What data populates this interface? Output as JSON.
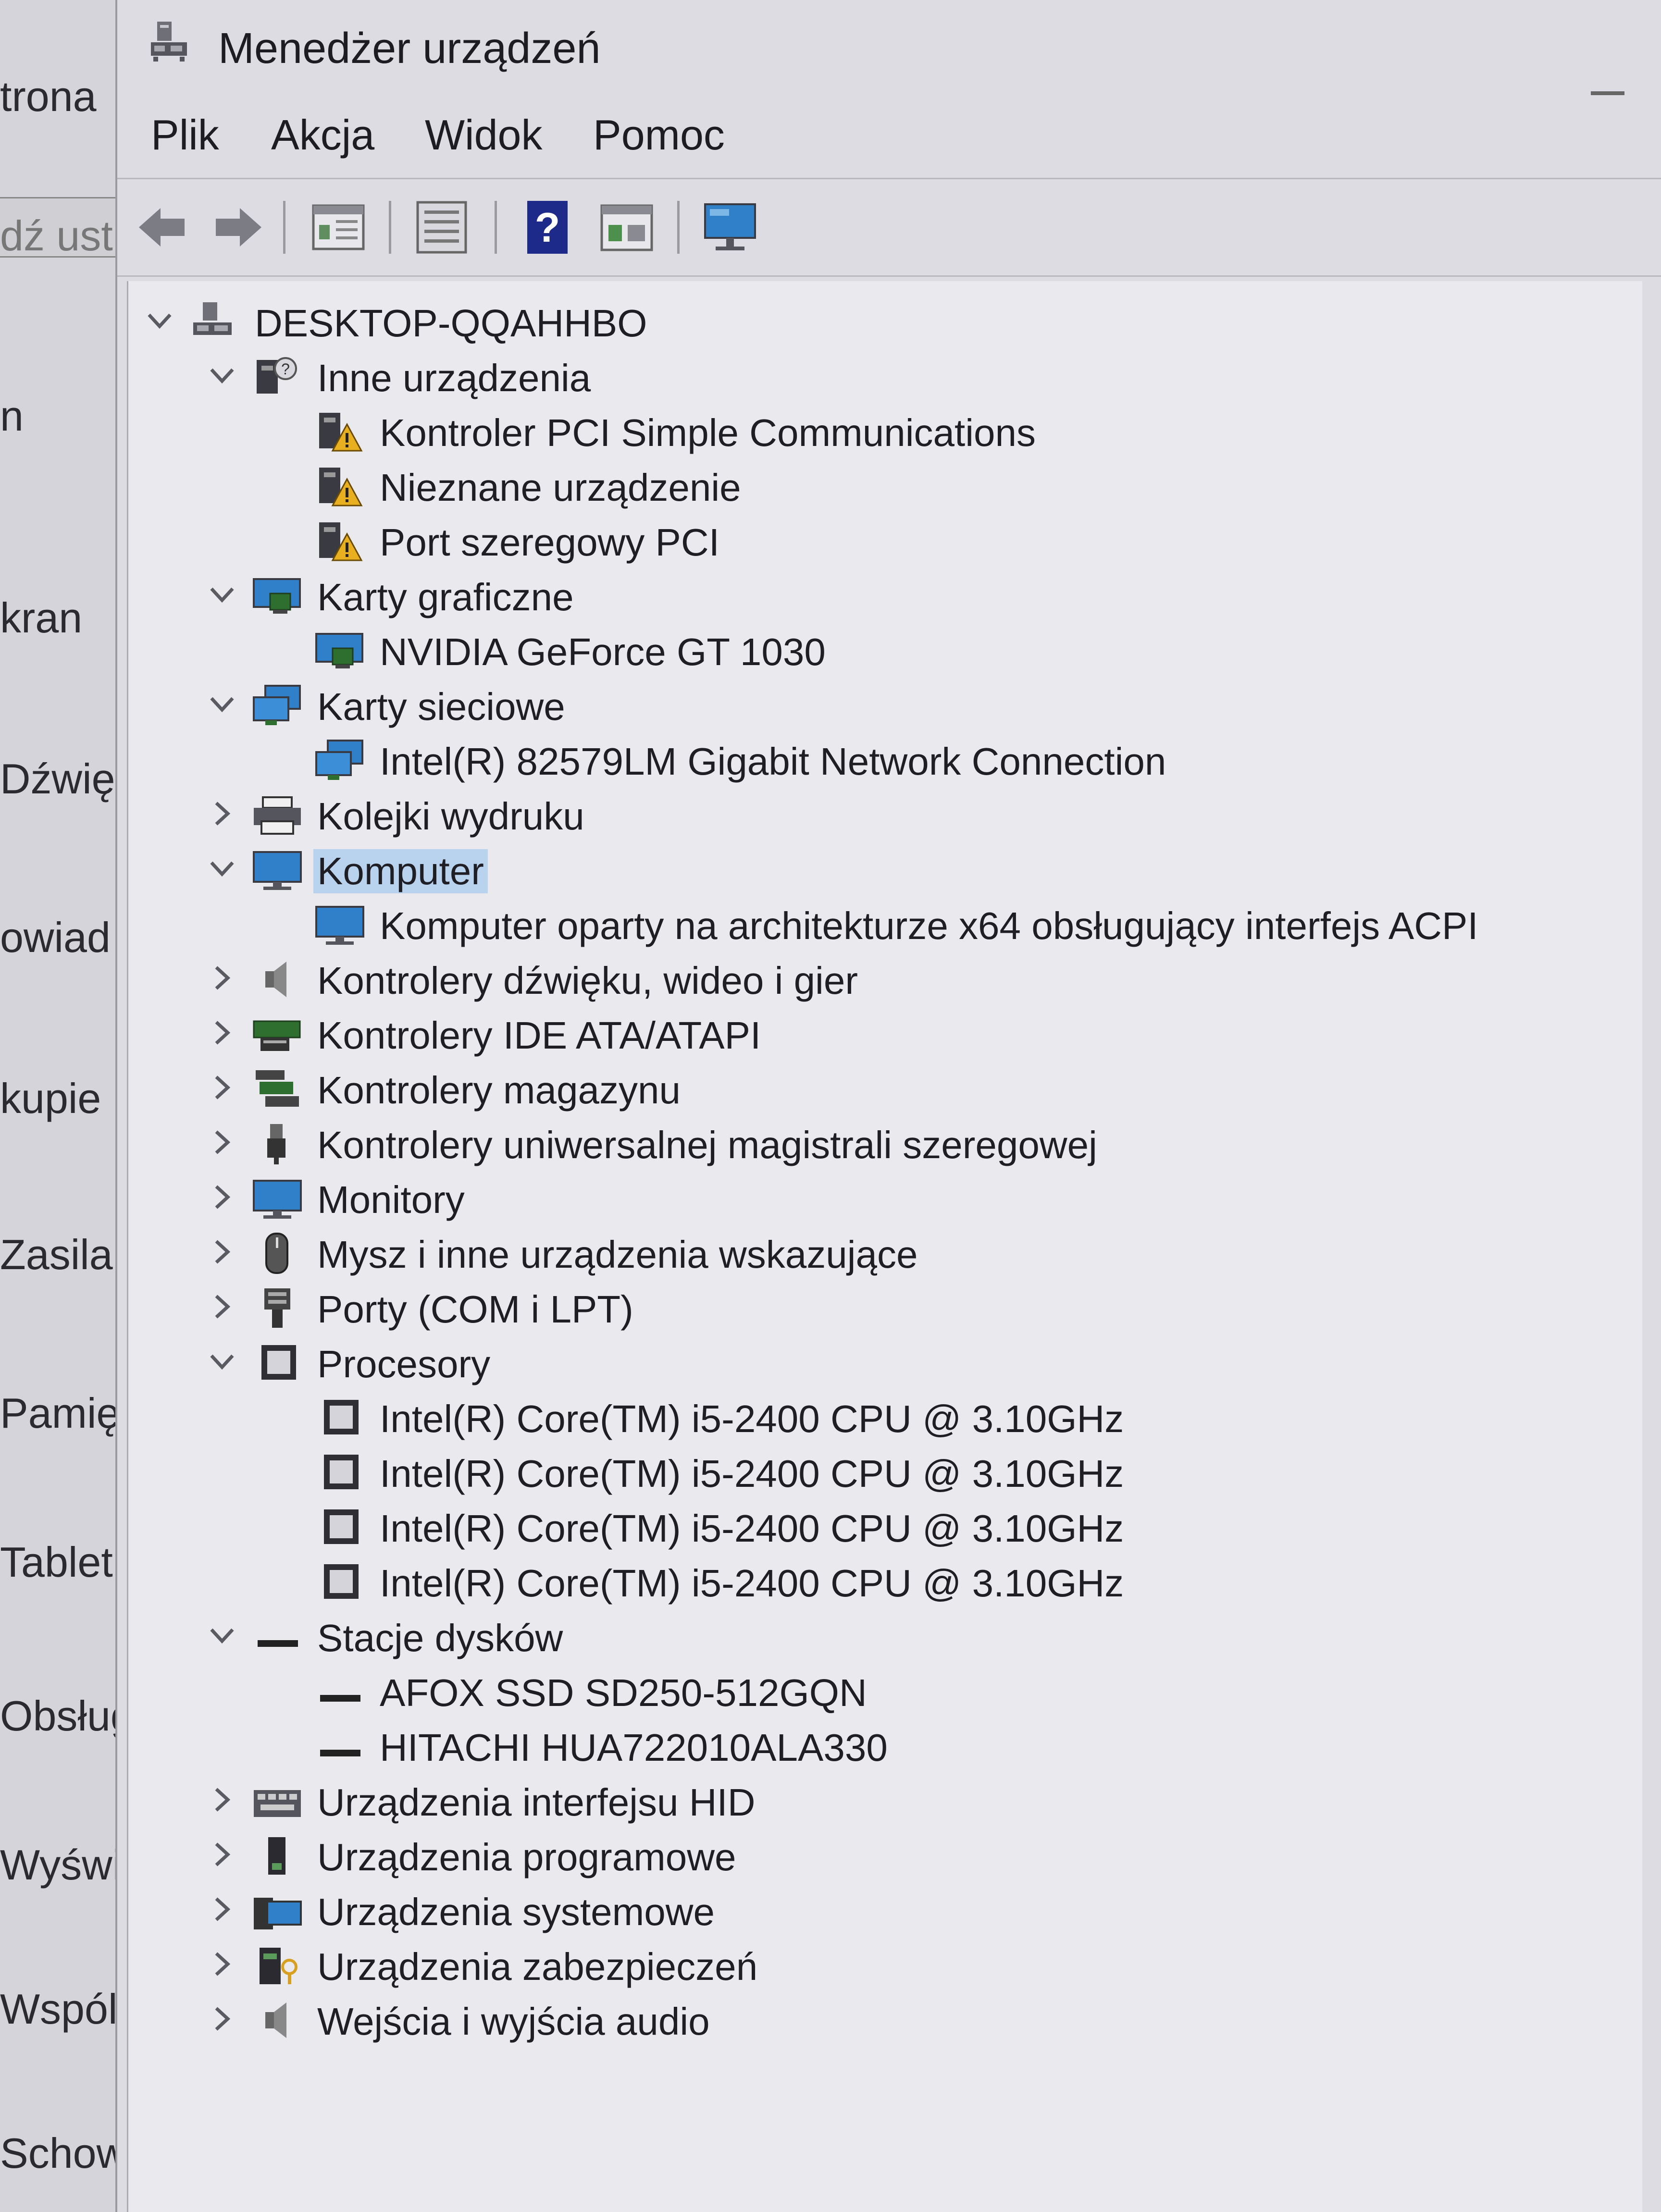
{
  "background_window": {
    "labels": [
      "trona",
      "dź ust",
      "n",
      "kran",
      "Dźwięk",
      "owiad",
      "kupie",
      "Zasilan",
      "Pamięć",
      "Tablet",
      "Obsług",
      "Wyświ",
      "Wspól",
      "Schow"
    ]
  },
  "window": {
    "title": "Menedżer urządzeń"
  },
  "menu": {
    "items": [
      "Plik",
      "Akcja",
      "Widok",
      "Pomoc"
    ]
  },
  "toolbar": {
    "buttons": [
      "back-arrow",
      "forward-arrow",
      "properties-window",
      "update-driver",
      "help",
      "run-window",
      "monitor"
    ]
  },
  "tree": {
    "root": "DESKTOP-QQAHHBO",
    "items": [
      {
        "label": "Inne urządzenia",
        "expanded": true,
        "icon": "other-devices",
        "children": [
          "Kontroler PCI Simple Communications",
          "Nieznane urządzenie",
          "Port szeregowy PCI"
        ]
      },
      {
        "label": "Karty graficzne",
        "expanded": true,
        "icon": "display-adapter",
        "children": [
          "NVIDIA GeForce GT 1030"
        ]
      },
      {
        "label": "Karty sieciowe",
        "expanded": true,
        "icon": "network-adapter",
        "children": [
          "Intel(R) 82579LM Gigabit Network Connection"
        ]
      },
      {
        "label": "Kolejki wydruku",
        "expanded": false,
        "icon": "printer"
      },
      {
        "label": "Komputer",
        "expanded": true,
        "icon": "computer",
        "selected": true,
        "children": [
          "Komputer oparty na architekturze x64 obsługujący interfejs ACPI"
        ]
      },
      {
        "label": "Kontrolery dźwięku, wideo i gier",
        "expanded": false,
        "icon": "speaker"
      },
      {
        "label": "Kontrolery IDE ATA/ATAPI",
        "expanded": false,
        "icon": "ide-controller"
      },
      {
        "label": "Kontrolery magazynu",
        "expanded": false,
        "icon": "storage-controller"
      },
      {
        "label": "Kontrolery uniwersalnej magistrali szeregowej",
        "expanded": false,
        "icon": "usb"
      },
      {
        "label": "Monitory",
        "expanded": false,
        "icon": "monitor"
      },
      {
        "label": "Mysz i inne urządzenia wskazujące",
        "expanded": false,
        "icon": "mouse"
      },
      {
        "label": "Porty (COM i LPT)",
        "expanded": false,
        "icon": "port"
      },
      {
        "label": "Procesory",
        "expanded": true,
        "icon": "processor",
        "children": [
          "Intel(R) Core(TM) i5-2400 CPU @ 3.10GHz",
          "Intel(R) Core(TM) i5-2400 CPU @ 3.10GHz",
          "Intel(R) Core(TM) i5-2400 CPU @ 3.10GHz",
          "Intel(R) Core(TM) i5-2400 CPU @ 3.10GHz"
        ]
      },
      {
        "label": "Stacje dysków",
        "expanded": true,
        "icon": "disk-drive",
        "children": [
          "AFOX SSD SD250-512GQN",
          "HITACHI HUA722010ALA330"
        ]
      },
      {
        "label": "Urządzenia interfejsu HID",
        "expanded": false,
        "icon": "hid"
      },
      {
        "label": "Urządzenia programowe",
        "expanded": false,
        "icon": "software-device"
      },
      {
        "label": "Urządzenia systemowe",
        "expanded": false,
        "icon": "system-devices"
      },
      {
        "label": "Urządzenia zabezpieczeń",
        "expanded": false,
        "icon": "security-device"
      },
      {
        "label": "Wejścia i wyjścia audio",
        "expanded": false,
        "icon": "audio-io"
      }
    ]
  },
  "colors": {
    "selection": "#b9d3ee",
    "tree_background": "#e9e9ee",
    "window_background": "#dcdce2"
  }
}
